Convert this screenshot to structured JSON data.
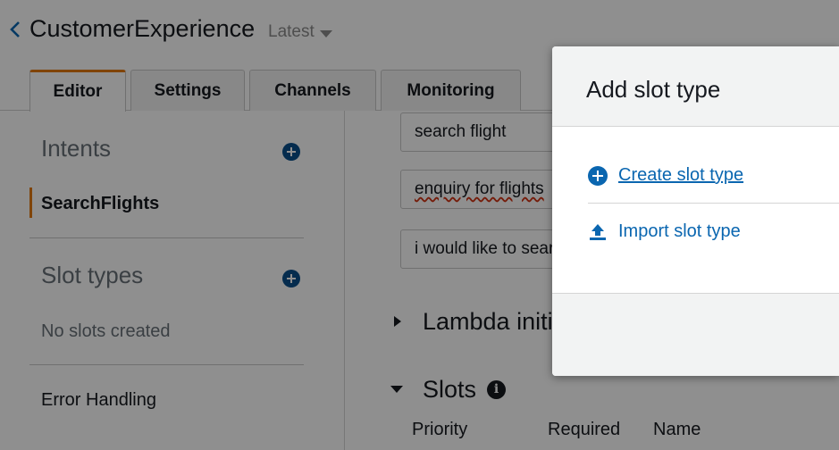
{
  "header": {
    "app_title": "CustomerExperience",
    "version": "Latest"
  },
  "tabs": [
    {
      "label": "Editor",
      "active": true
    },
    {
      "label": "Settings"
    },
    {
      "label": "Channels"
    },
    {
      "label": "Monitoring"
    }
  ],
  "sidebar": {
    "intents_title": "Intents",
    "intents": [
      "SearchFlights"
    ],
    "slot_types_title": "Slot types",
    "slot_types_empty": "No slots created",
    "error_handling": "Error Handling"
  },
  "main": {
    "utterances": [
      "search flight",
      "enquiry for flights",
      "i would like to search a flight"
    ],
    "lambda_heading": "Lambda initialization and validation",
    "slots_heading": "Slots",
    "slot_columns": [
      "Priority",
      "Required",
      "Name"
    ]
  },
  "modal": {
    "title": "Add slot type",
    "create_label": "Create slot type",
    "import_label": "Import slot type"
  },
  "colors": {
    "link": "#0a66b0",
    "accent": "#e47911",
    "overlay": "rgba(0,0,0,0.44)"
  }
}
